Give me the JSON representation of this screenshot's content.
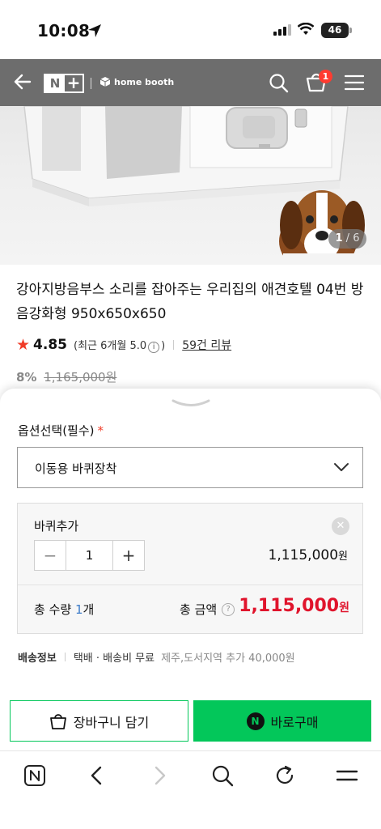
{
  "status_bar": {
    "time": "10:08",
    "battery": "46"
  },
  "nav": {
    "logo_n": "N",
    "logo_plus": "+",
    "brand": "home booth",
    "cart_count": "1"
  },
  "gallery": {
    "current": "1",
    "separator": " / ",
    "total": "6"
  },
  "product": {
    "title": "강아지방음부스 소리를 잡아주는 우리집의 애견호텔 04번 방음강화형 950x650x650",
    "rating": "4.85",
    "recent_rating_prefix": "(최근 6개월 5.0",
    "recent_rating_suffix": ")",
    "reviews": "59건 리뷰",
    "discount": "8%",
    "original_price": "1,165,000원"
  },
  "options": {
    "label": "옵션선택(필수)",
    "required_mark": "*",
    "selected": "이동용 바퀴장착",
    "item_name": "바퀴추가",
    "quantity": "1",
    "item_price": "1,115,000",
    "currency": "원",
    "total_qty_prefix": "총 수량 ",
    "total_qty_num": "1",
    "total_qty_unit": "개",
    "total_amount_label": "총 금액",
    "total_amount": "1,115,000"
  },
  "shipping": {
    "label": "배송정보",
    "method": "택배 · 배송비 무료",
    "extra": "제주,도서지역 추가 40,000원"
  },
  "actions": {
    "cart": "장바구니 담기",
    "buy": "바로구매",
    "npay": "N"
  },
  "colors": {
    "accent_green": "#03c75a",
    "price_red": "#e0142c",
    "nav_gray": "#6d6d6d"
  },
  "icons": [
    "location-arrow-icon",
    "signal-icon",
    "wifi-icon",
    "back-arrow-icon",
    "search-icon",
    "cart-icon",
    "menu-icon",
    "chevron-down-icon",
    "close-icon",
    "info-icon",
    "help-icon",
    "bag-icon",
    "naver-icon",
    "back-icon",
    "forward-icon",
    "refresh-icon"
  ]
}
